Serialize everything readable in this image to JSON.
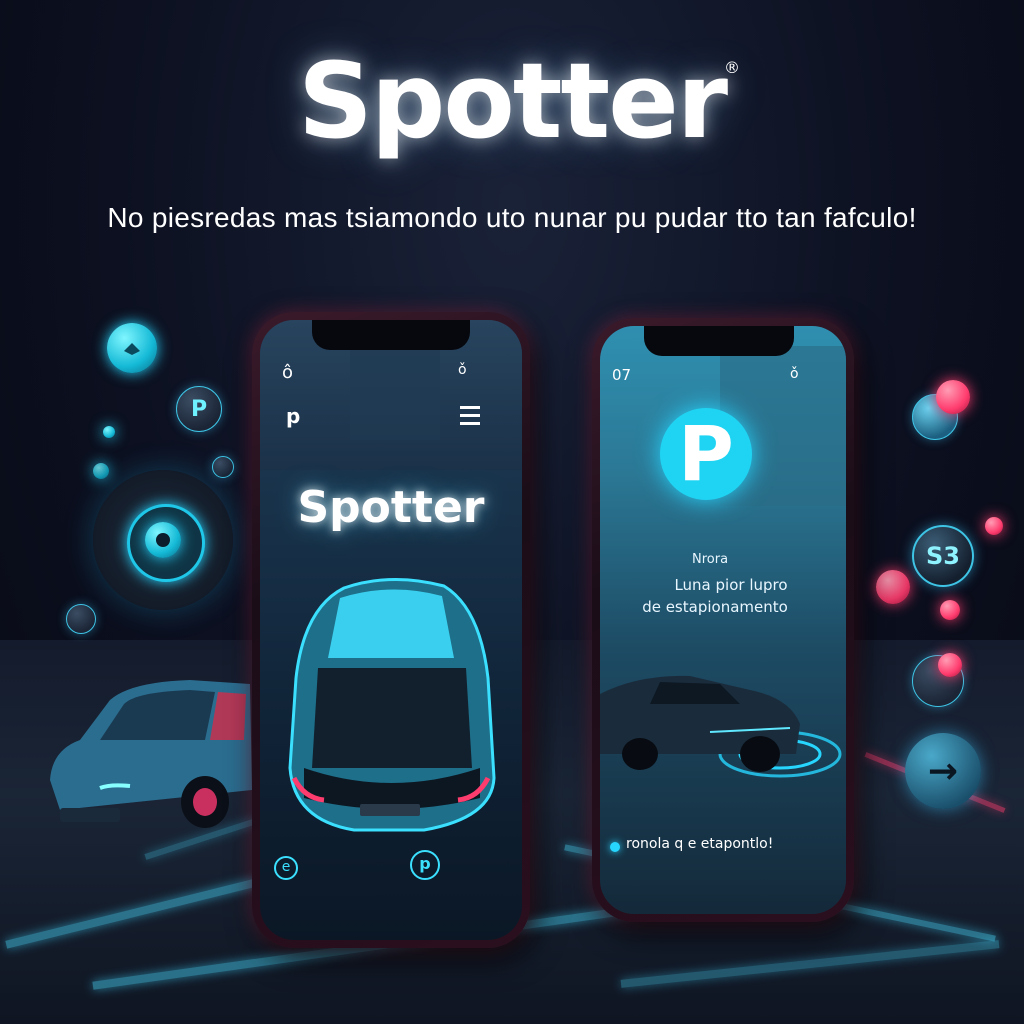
{
  "brand": {
    "name": "Spotter",
    "registered": "®"
  },
  "tagline": "No piesredas mas tsiamondo uto nunar pu pudar tto tan fafculo!",
  "left_phone": {
    "status_left": "ô",
    "status_right": "ǒ",
    "top_icon": "p",
    "app_title": "Spotter",
    "bottom_left_icon": "e",
    "bottom_right_icon": "p"
  },
  "right_phone": {
    "status_left": "07",
    "status_right": "ǒ",
    "logo_letter": "P",
    "label_small": "Nrora",
    "headline_line1": "Luna pior lupro",
    "headline_line2": "de estapionamento",
    "bottom_text": "ronola q e etapontlo!"
  },
  "badges": {
    "s3": "S3",
    "arrow": "→",
    "p_small": "P"
  },
  "colors": {
    "accent_cyan": "#27d6ff",
    "accent_pink": "#ff3c6e",
    "bg": "#0c1020"
  }
}
